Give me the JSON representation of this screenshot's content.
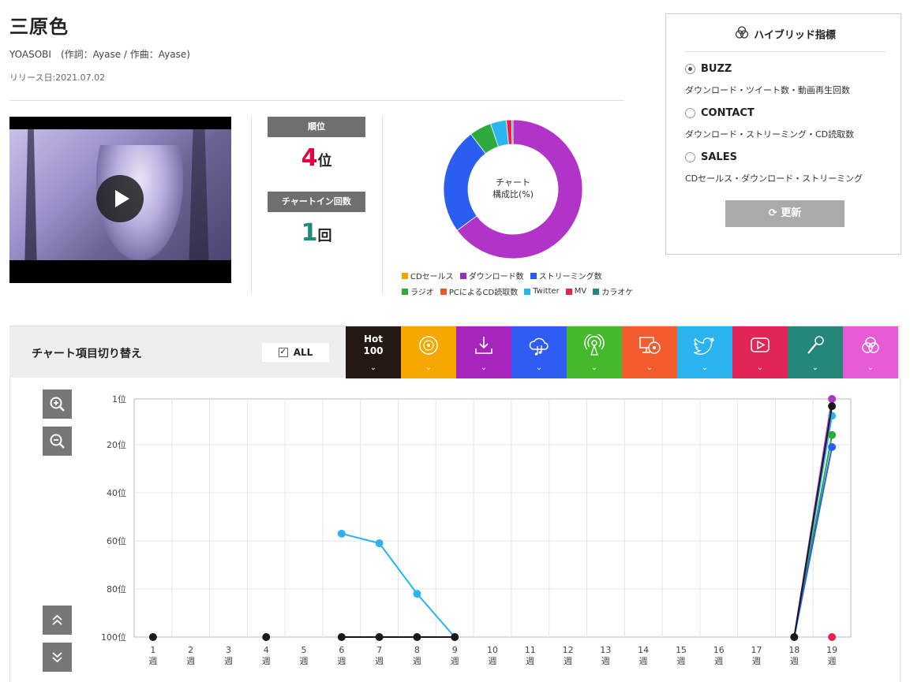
{
  "song": {
    "title": "三原色",
    "artist": "YOASOBI　(作詞：Ayase / 作曲：Ayase)",
    "release": "リリース日:2021.07.02"
  },
  "rank": {
    "label": "順位",
    "value": "4",
    "unit": "位",
    "chartin_label": "チャートイン回数",
    "chartin_value": "1",
    "chartin_unit": "回"
  },
  "donut": {
    "center_line1": "チャート",
    "center_line2": "構成比(%)",
    "segments": [
      {
        "name": "ダウンロード数",
        "value": 63,
        "color": "#b233c8"
      },
      {
        "name": "ストリーミング数",
        "value": 24,
        "color": "#2a5ef0"
      },
      {
        "name": "ラジオ",
        "value": 5,
        "color": "#2eaa3c"
      },
      {
        "name": "Twitter",
        "value": 3.6,
        "color": "#29b6f0"
      },
      {
        "name": "MV",
        "value": 1.2,
        "color": "#e8224a"
      },
      {
        "name": "カラオケ",
        "value": 0.3,
        "color": "#238a77"
      }
    ]
  },
  "legend": {
    "row1": [
      {
        "label": "CDセールス",
        "color": "#f5a300"
      },
      {
        "label": "ダウンロード数",
        "color": "#9b2cb4"
      },
      {
        "label": "ストリーミング数",
        "color": "#2a5ef0"
      }
    ],
    "row2": [
      {
        "label": "ラジオ",
        "color": "#2eaa3c"
      },
      {
        "label": "PCによるCD読取数",
        "color": "#f0562a"
      },
      {
        "label": "Twitter",
        "color": "#29b6f0"
      },
      {
        "label": "MV",
        "color": "#e8224a"
      },
      {
        "label": "カラオケ",
        "color": "#238a77"
      }
    ]
  },
  "hybrid": {
    "title": "ハイブリッド指標",
    "options": [
      {
        "label": "BUZZ",
        "desc": "ダウンロード・ツイート数・動画再生回数",
        "selected": true
      },
      {
        "label": "CONTACT",
        "desc": "ダウンロード・ストリーミング・CD読取数",
        "selected": false
      },
      {
        "label": "SALES",
        "desc": "CDセールス・ダウンロード・ストリーミング",
        "selected": false
      }
    ],
    "refresh_label": "更新"
  },
  "switcher": {
    "label": "チャート項目切り替え",
    "all_label": "ALL",
    "hot_line1": "Hot",
    "hot_line2": "100",
    "tabs": [
      {
        "name": "cd-sales",
        "color": "#f7a800",
        "icon": "disc-icon"
      },
      {
        "name": "download",
        "color": "#a626bd",
        "icon": "download-icon"
      },
      {
        "name": "streaming",
        "color": "#2f5cf2",
        "icon": "cloud-music-icon"
      },
      {
        "name": "radio",
        "color": "#43b92b",
        "icon": "radio-icon"
      },
      {
        "name": "pc-cd-read",
        "color": "#f45b2d",
        "icon": "pc-disc-icon"
      },
      {
        "name": "twitter",
        "color": "#2ab3ef",
        "icon": "twitter-icon"
      },
      {
        "name": "mv",
        "color": "#e12554",
        "icon": "play-video-icon"
      },
      {
        "name": "karaoke",
        "color": "#24877a",
        "icon": "microphone-icon"
      },
      {
        "name": "hybrid",
        "color": "#e85bd6",
        "icon": "venn-icon"
      }
    ],
    "chevron": "⌄"
  },
  "chart_data": {
    "type": "line",
    "x": [
      1,
      2,
      3,
      4,
      5,
      6,
      7,
      8,
      9,
      10,
      11,
      12,
      13,
      14,
      15,
      16,
      17,
      18,
      19
    ],
    "xticks": [
      "1",
      "2",
      "3",
      "4",
      "5",
      "6",
      "7",
      "8",
      "9",
      "10",
      "11",
      "12",
      "13",
      "14",
      "15",
      "16",
      "17",
      "18",
      "19"
    ],
    "xunit": "週",
    "yticks": [
      "1位",
      "20位",
      "40位",
      "60位",
      "80位",
      "100位"
    ],
    "ylim": [
      1,
      100
    ],
    "inverted": true,
    "grid": true,
    "series": [
      {
        "key": "hot100",
        "color": "#1a1a1a",
        "points": [
          [
            1,
            100
          ],
          [
            4,
            100
          ],
          [
            6,
            100
          ],
          [
            7,
            100
          ],
          [
            8,
            100
          ],
          [
            9,
            100
          ],
          [
            18,
            100
          ],
          [
            19,
            4
          ]
        ]
      },
      {
        "key": "twitter",
        "color": "#2ab3ef",
        "points": [
          [
            6,
            57
          ],
          [
            7,
            61
          ],
          [
            8,
            82
          ],
          [
            9,
            100
          ]
        ]
      },
      {
        "key": "download",
        "color": "#b233c8",
        "points": [
          [
            18,
            100
          ],
          [
            19,
            1
          ]
        ]
      },
      {
        "key": "twitter19",
        "color": "#2ab3ef",
        "points": [
          [
            18,
            100
          ],
          [
            19,
            8
          ]
        ]
      },
      {
        "key": "radio",
        "color": "#2eaa3c",
        "points": [
          [
            18,
            100
          ],
          [
            19,
            16
          ]
        ]
      },
      {
        "key": "streaming",
        "color": "#2a5ef0",
        "points": [
          [
            18,
            100
          ],
          [
            19,
            21
          ]
        ]
      },
      {
        "key": "mv",
        "color": "#e8224a",
        "points": [
          [
            19,
            100
          ]
        ]
      }
    ]
  }
}
